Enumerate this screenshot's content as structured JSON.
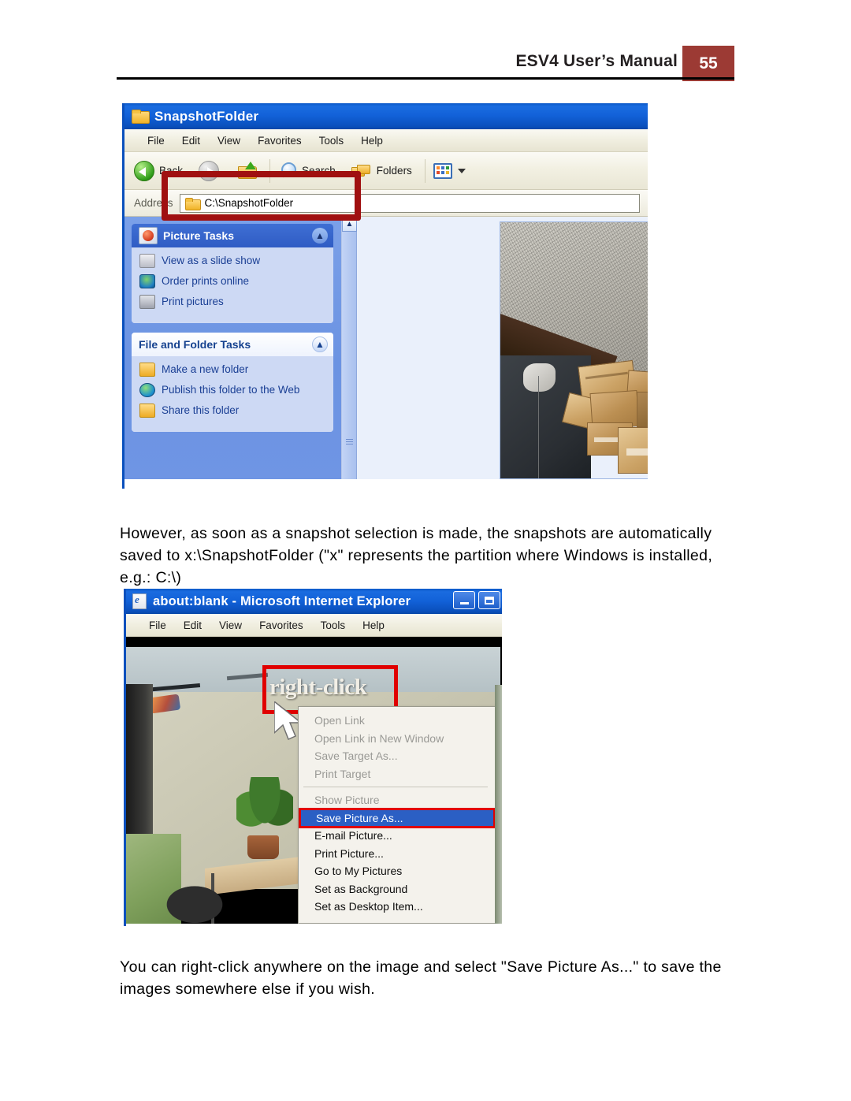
{
  "header": {
    "title": "ESV4 User’s Manual",
    "page_number": "55",
    "accent_color": "#9c3a34"
  },
  "paragraphs": {
    "first": "However, as soon as a snapshot selection is made, the snapshots are automatically saved to x:\\SnapshotFolder (\"x\" represents the partition where Windows is installed, e.g.: C:\\)",
    "second": "You can right-click anywhere on the image and select \"Save Picture As...\" to save the images somewhere else if you wish."
  },
  "explorer_window": {
    "title": "SnapshotFolder",
    "title_icon": "folder-icon",
    "menu_items": [
      "File",
      "Edit",
      "View",
      "Favorites",
      "Tools",
      "Help"
    ],
    "toolbar": {
      "back_label": "Back",
      "back_icon": "back-arrow-icon",
      "forward_icon": "forward-arrow-icon",
      "up_icon": "up-folder-icon",
      "search_label": "Search",
      "search_icon": "search-magnifier-icon",
      "folders_label": "Folders",
      "folders_icon": "folders-icon",
      "views_icon": "views-icon",
      "views_caret_icon": "chevron-down-icon"
    },
    "address_bar": {
      "label": "Address",
      "value": "C:\\SnapshotFolder",
      "icon": "folder-icon"
    },
    "sidebar": {
      "picture_tasks": {
        "title": "Picture Tasks",
        "collapse_icon": "chevron-up-icon",
        "header_icon": "picture-tasks-icon",
        "items": [
          {
            "label": "View as a slide show",
            "icon": "slideshow-icon"
          },
          {
            "label": "Order prints online",
            "icon": "order-prints-icon"
          },
          {
            "label": "Print pictures",
            "icon": "print-pictures-icon"
          }
        ]
      },
      "file_and_folder_tasks": {
        "title": "File and Folder Tasks",
        "collapse_icon": "chevron-up-icon",
        "items": [
          {
            "label": "Make a new folder",
            "icon": "new-folder-icon"
          },
          {
            "label": "Publish this folder to the Web",
            "icon": "publish-web-icon"
          },
          {
            "label": "Share this folder",
            "icon": "share-folder-icon"
          }
        ]
      }
    },
    "highlight_color": "#a01010"
  },
  "ie_window": {
    "title": "about:blank - Microsoft Internet Explorer",
    "title_icon": "ie-document-icon",
    "menu_items": [
      "File",
      "Edit",
      "View",
      "Favorites",
      "Tools",
      "Help"
    ],
    "controls": [
      {
        "name": "minimize-button",
        "icon": "minimize-icon"
      },
      {
        "name": "maximize-button",
        "icon": "maximize-icon"
      }
    ],
    "annotation": {
      "text": "right-click",
      "cursor_icon": "mouse-pointer-icon",
      "box_color": "#e00000"
    },
    "context_menu": {
      "items": [
        {
          "label": "Open Link",
          "state": "disabled"
        },
        {
          "label": "Open Link in New Window",
          "state": "disabled"
        },
        {
          "label": "Save Target As...",
          "state": "disabled"
        },
        {
          "label": "Print Target",
          "state": "disabled"
        },
        {
          "separator": true
        },
        {
          "label": "Show Picture",
          "state": "disabled"
        },
        {
          "label": "Save Picture As...",
          "state": "selected"
        },
        {
          "label": "E-mail Picture...",
          "state": "normal"
        },
        {
          "label": "Print Picture...",
          "state": "normal"
        },
        {
          "label": "Go to My Pictures",
          "state": "normal"
        },
        {
          "label": "Set as Background",
          "state": "normal"
        },
        {
          "label": "Set as Desktop Item...",
          "state": "normal"
        }
      ],
      "selected_bg": "#2b5fc4",
      "highlight_outline": "#e00000"
    }
  }
}
